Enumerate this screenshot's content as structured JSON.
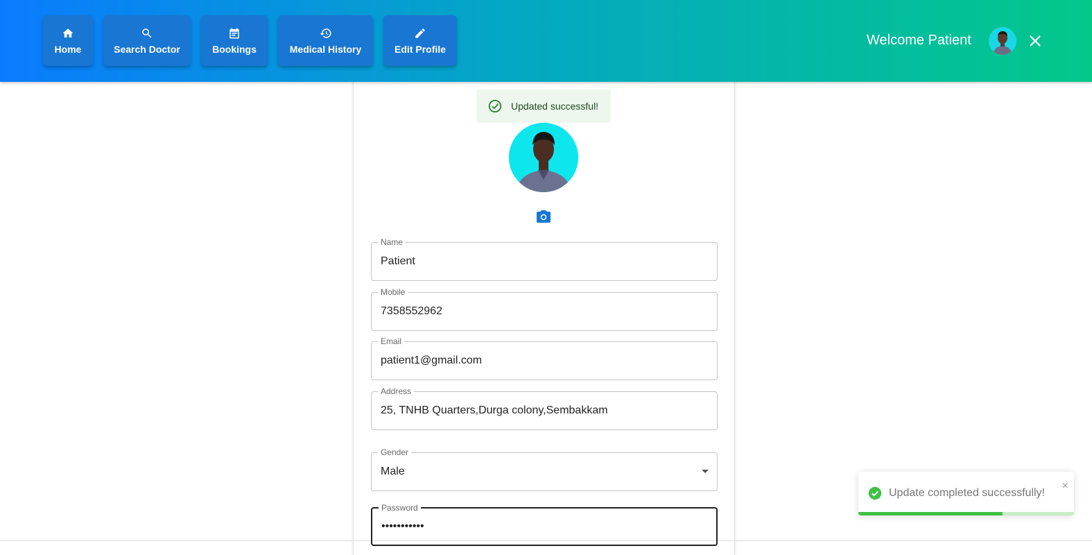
{
  "header": {
    "nav": [
      {
        "label": "Home",
        "icon": "home-icon"
      },
      {
        "label": "Search Doctor",
        "icon": "search-icon"
      },
      {
        "label": "Bookings",
        "icon": "calendar-icon"
      },
      {
        "label": "Medical History",
        "icon": "history-icon"
      },
      {
        "label": "Edit Profile",
        "icon": "pencil-icon"
      }
    ],
    "welcome": "Welcome Patient",
    "close_icon": "close-icon",
    "gradient_colors": [
      "#0a7bff",
      "#03c88a"
    ]
  },
  "alert": {
    "message": "Updated successful!",
    "icon": "check-circle-icon",
    "color": "#2e7d32"
  },
  "profile": {
    "camera_icon": "camera-icon",
    "fields": {
      "name": {
        "label": "Name",
        "value": "Patient"
      },
      "mobile": {
        "label": "Mobile",
        "value": "7358552962"
      },
      "email": {
        "label": "Email",
        "value": "patient1@gmail.com"
      },
      "address": {
        "label": "Address",
        "value": "25, TNHB Quarters,Durga colony,Sembakkam"
      },
      "gender": {
        "label": "Gender",
        "value": "Male"
      },
      "password": {
        "label": "Password",
        "value": "•••••••••••"
      }
    }
  },
  "toast": {
    "message": "Update completed successfully!",
    "close": "×",
    "progress": 0.67,
    "accent": "#3ec244"
  }
}
